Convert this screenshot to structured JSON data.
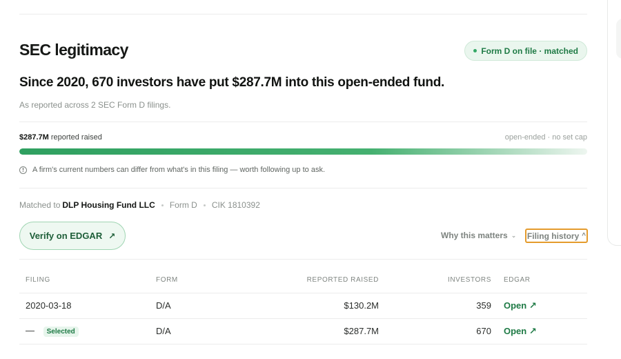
{
  "section": {
    "title": "SEC legitimacy",
    "badge": "Form D on file · matched"
  },
  "summary": {
    "headline": "Since 2020, 670 investors have put $287.7M into this open-ended fund.",
    "subline": "As reported across 2 SEC Form D filings."
  },
  "raised": {
    "amount": "$287.7M",
    "label": "reported raised",
    "cap_note": "open-ended · no set cap",
    "fill_percent": 100
  },
  "disclaimer": "A firm's current numbers can differ from what's in this filing — worth following up to ask.",
  "match": {
    "prefix": "Matched to",
    "entity": "DLP Housing Fund LLC",
    "form": "Form D",
    "cik": "CIK 1810392"
  },
  "actions": {
    "verify_label": "Verify on EDGAR",
    "why_label": "Why this matters",
    "history_label": "Filing history"
  },
  "table": {
    "headers": [
      "FILING",
      "FORM",
      "REPORTED RAISED",
      "INVESTORS",
      "EDGAR"
    ],
    "rows": [
      {
        "filing": "2020-03-18",
        "selected": "",
        "form": "D/A",
        "raised": "$130.2M",
        "investors": "359",
        "edgar": "Open"
      },
      {
        "filing": "—",
        "selected": "Selected",
        "form": "D/A",
        "raised": "$287.7M",
        "investors": "670",
        "edgar": "Open"
      }
    ]
  },
  "icons": {
    "external": "arrow-up-right-icon",
    "info": "info-icon"
  },
  "colors": {
    "accent_green": "#2fa060",
    "badge_bg": "#eaf6ee",
    "focus_outline": "#e49b2c"
  }
}
